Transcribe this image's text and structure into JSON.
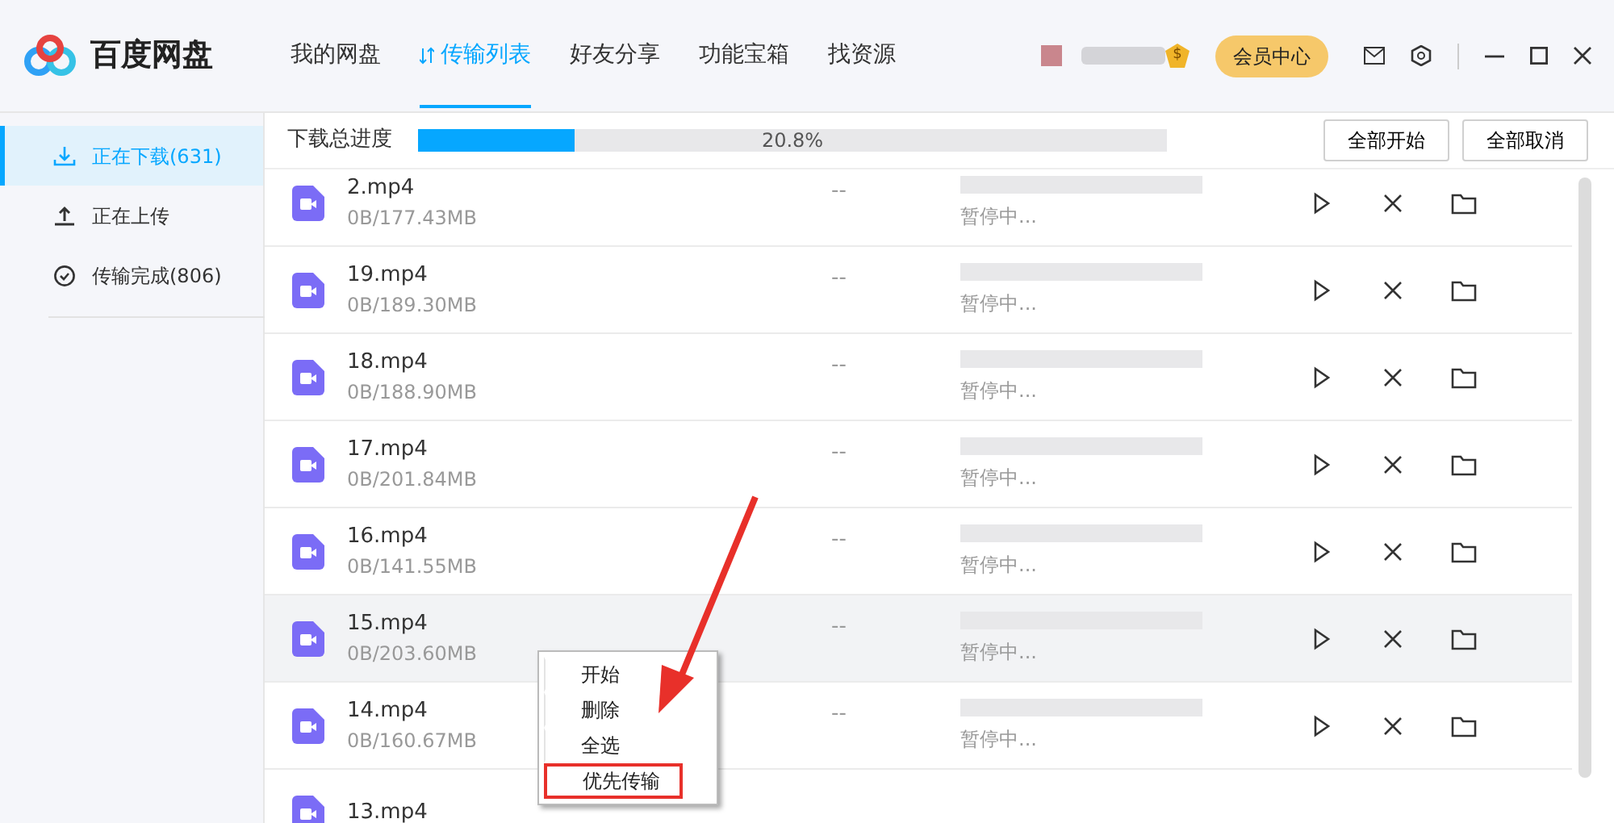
{
  "app": {
    "logo_text": "百度网盘"
  },
  "nav_tabs": [
    {
      "label": "我的网盘",
      "selected": false
    },
    {
      "label": "传输列表",
      "selected": true
    },
    {
      "label": "好友分享",
      "selected": false
    },
    {
      "label": "功能宝箱",
      "selected": false
    },
    {
      "label": "找资源",
      "selected": false
    }
  ],
  "user": {
    "badge": "$",
    "vip_button": "会员中心"
  },
  "sidebar": {
    "items": [
      {
        "label": "正在下载(631)",
        "kind": "download",
        "selected": true
      },
      {
        "label": "正在上传",
        "kind": "upload",
        "selected": false
      },
      {
        "label": "传输完成(806)",
        "kind": "done",
        "selected": false
      }
    ]
  },
  "overall": {
    "label": "下载总进度",
    "level": 0.208,
    "reading": "20.8%",
    "buttons": [
      "全部开始",
      "全部取消"
    ]
  },
  "rows": [
    {
      "name": "2.mp4",
      "size": "0B/177.43MB",
      "speed": "--",
      "status": "暂停中...",
      "selected": false
    },
    {
      "name": "19.mp4",
      "size": "0B/189.30MB",
      "speed": "--",
      "status": "暂停中...",
      "selected": false
    },
    {
      "name": "18.mp4",
      "size": "0B/188.90MB",
      "speed": "--",
      "status": "暂停中...",
      "selected": false
    },
    {
      "name": "17.mp4",
      "size": "0B/201.84MB",
      "speed": "--",
      "status": "暂停中...",
      "selected": false
    },
    {
      "name": "16.mp4",
      "size": "0B/141.55MB",
      "speed": "--",
      "status": "暂停中...",
      "selected": false
    },
    {
      "name": "15.mp4",
      "size": "0B/203.60MB",
      "speed": "--",
      "status": "暂停中...",
      "selected": true
    },
    {
      "name": "14.mp4",
      "size": "0B/160.67MB",
      "speed": "--",
      "status": "暂停中...",
      "selected": false
    },
    {
      "name": "13.mp4",
      "selected": false
    }
  ],
  "context_menu": {
    "items": [
      {
        "label": "开始",
        "highlighted": false
      },
      {
        "label": "删除",
        "highlighted": false
      },
      {
        "label": "全选",
        "highlighted": false
      },
      {
        "label": "优先传输",
        "highlighted": true
      }
    ]
  }
}
